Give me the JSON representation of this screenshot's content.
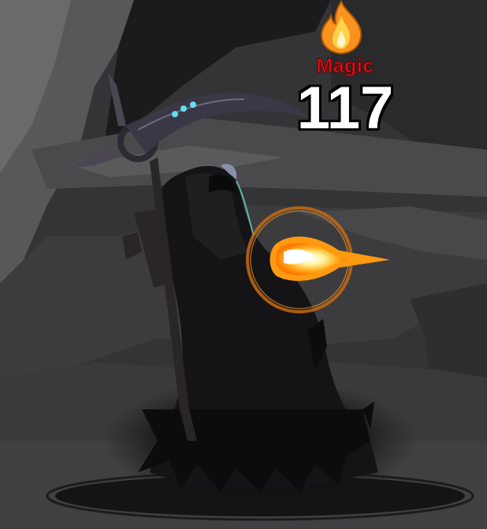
{
  "popup": {
    "icon": "flame-icon",
    "damage_type": "Magic",
    "damage_value": "117",
    "damage_type_color": "#e0101a",
    "flame_color": "#f7931e"
  },
  "scene": {
    "icon": "reaper-enemy",
    "projectile": "fireball"
  }
}
